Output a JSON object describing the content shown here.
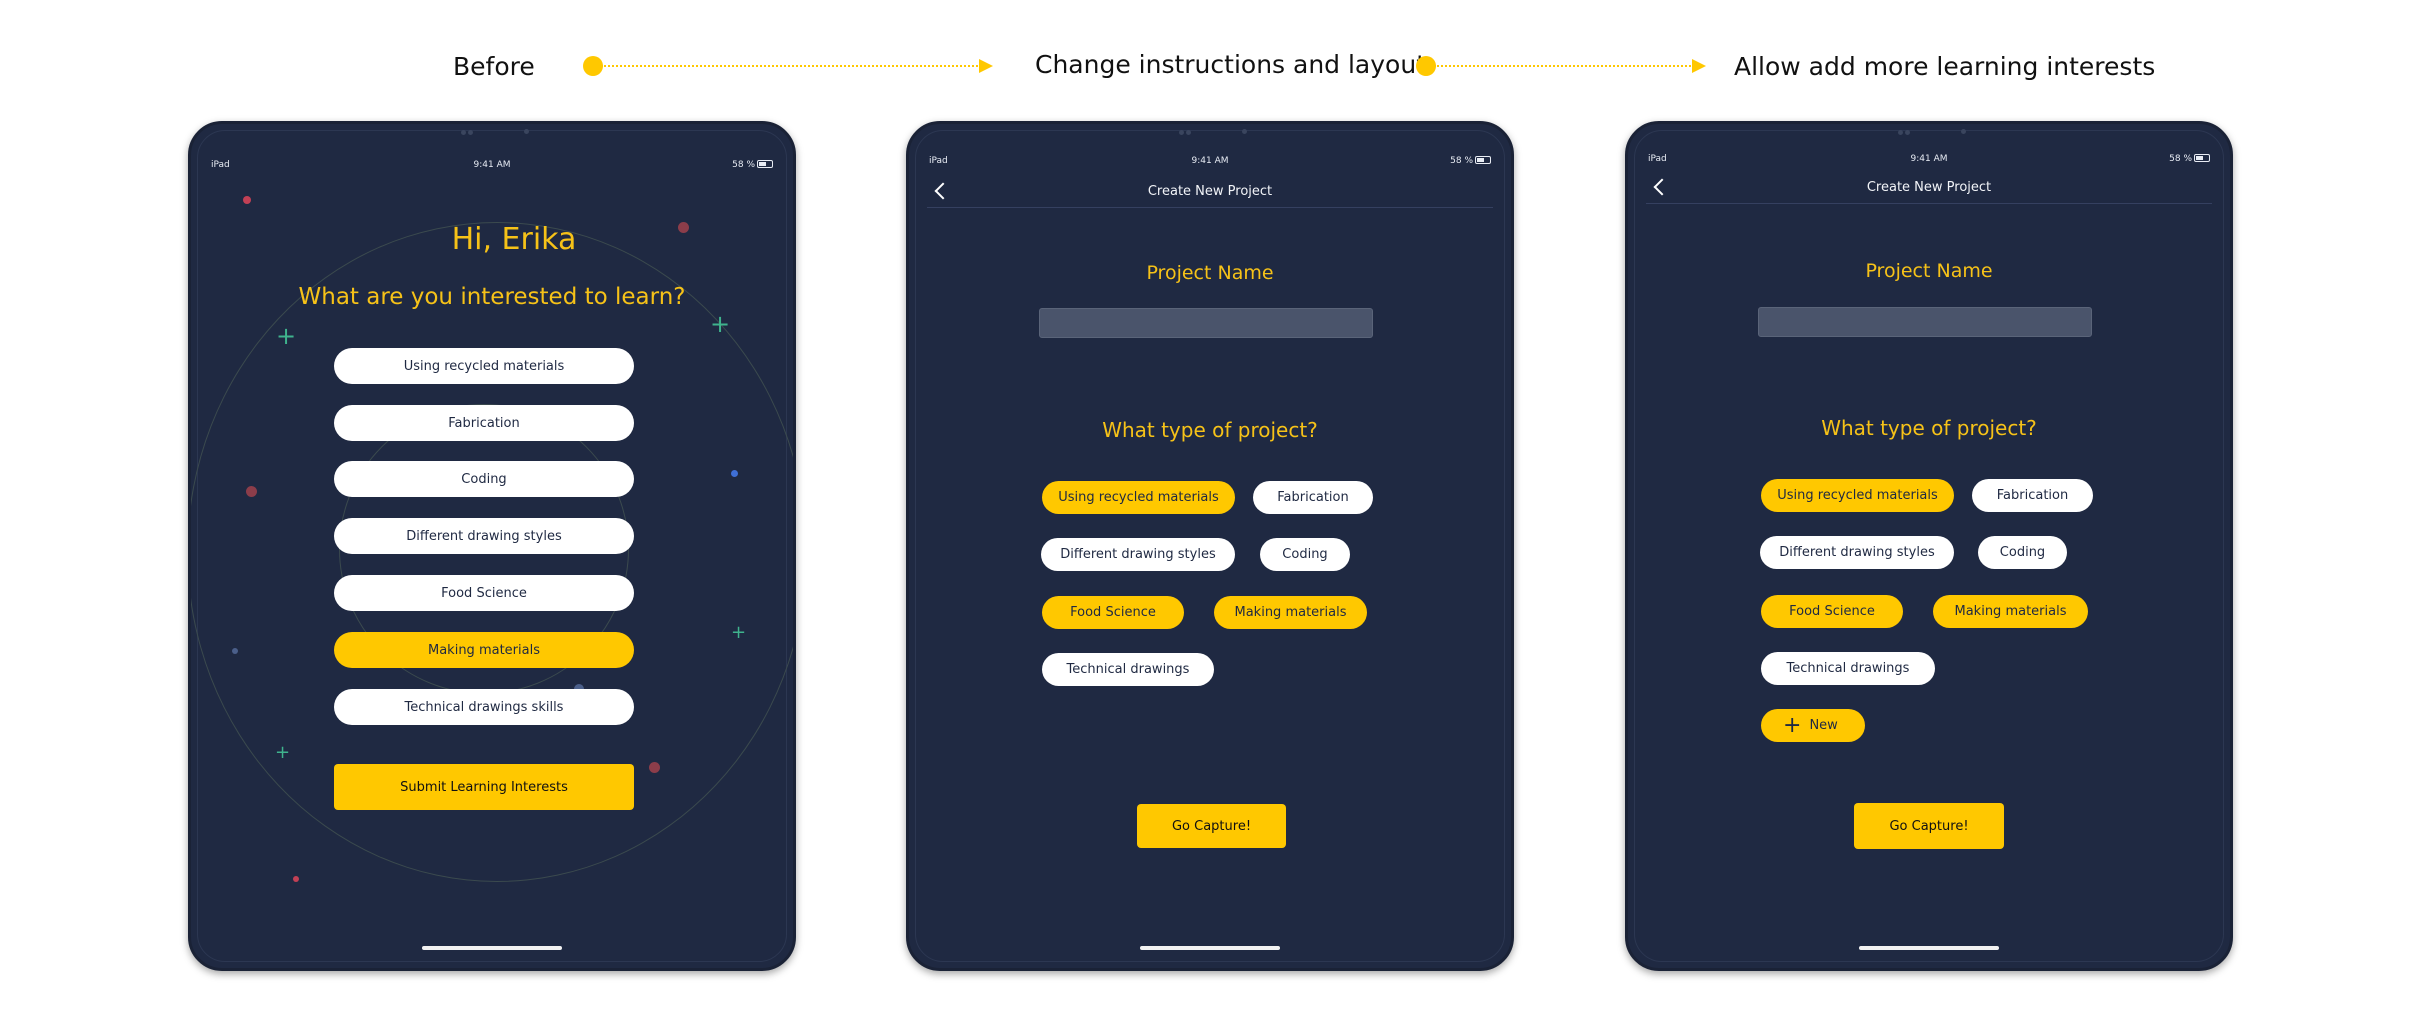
{
  "flow": {
    "step1": "Before",
    "step2": "Change instructions and layout",
    "step3": "Allow add more learning interests"
  },
  "status_bar": {
    "device": "iPad",
    "time": "9:41 AM",
    "battery": "58 %"
  },
  "before_screen": {
    "greeting": "Hi, Erika",
    "question": "What are you interested to learn?",
    "options": [
      {
        "label": "Using recycled materials",
        "selected": false
      },
      {
        "label": "Fabrication",
        "selected": false
      },
      {
        "label": "Coding",
        "selected": false
      },
      {
        "label": "Different drawing styles",
        "selected": false
      },
      {
        "label": "Food Science",
        "selected": false
      },
      {
        "label": "Making materials",
        "selected": true
      },
      {
        "label": "Technical drawings skills",
        "selected": false
      }
    ],
    "submit_label": "Submit Learning Interests"
  },
  "project_screen_v2": {
    "nav_title": "Create New Project",
    "name_label": "Project Name",
    "type_label": "What type of project?",
    "tags": [
      {
        "label": "Using recycled materials",
        "selected": true
      },
      {
        "label": "Fabrication",
        "selected": false
      },
      {
        "label": "Different drawing styles",
        "selected": false
      },
      {
        "label": "Coding",
        "selected": false
      },
      {
        "label": "Food Science",
        "selected": true
      },
      {
        "label": "Making materials",
        "selected": true
      },
      {
        "label": "Technical drawings",
        "selected": false
      }
    ],
    "capture_label": "Go Capture!"
  },
  "project_screen_v3": {
    "nav_title": "Create New Project",
    "name_label": "Project Name",
    "type_label": "What type of project?",
    "tags": [
      {
        "label": "Using recycled materials",
        "selected": true
      },
      {
        "label": "Fabrication",
        "selected": false
      },
      {
        "label": "Different drawing styles",
        "selected": false
      },
      {
        "label": "Coding",
        "selected": false
      },
      {
        "label": "Food Science",
        "selected": true
      },
      {
        "label": "Making materials",
        "selected": true
      },
      {
        "label": "Technical drawings",
        "selected": false
      }
    ],
    "new_label": "New",
    "capture_label": "Go Capture!"
  },
  "colors": {
    "accent": "#FFC800",
    "title_yellow": "#F6C218",
    "screen_bg": "#1f2942"
  }
}
